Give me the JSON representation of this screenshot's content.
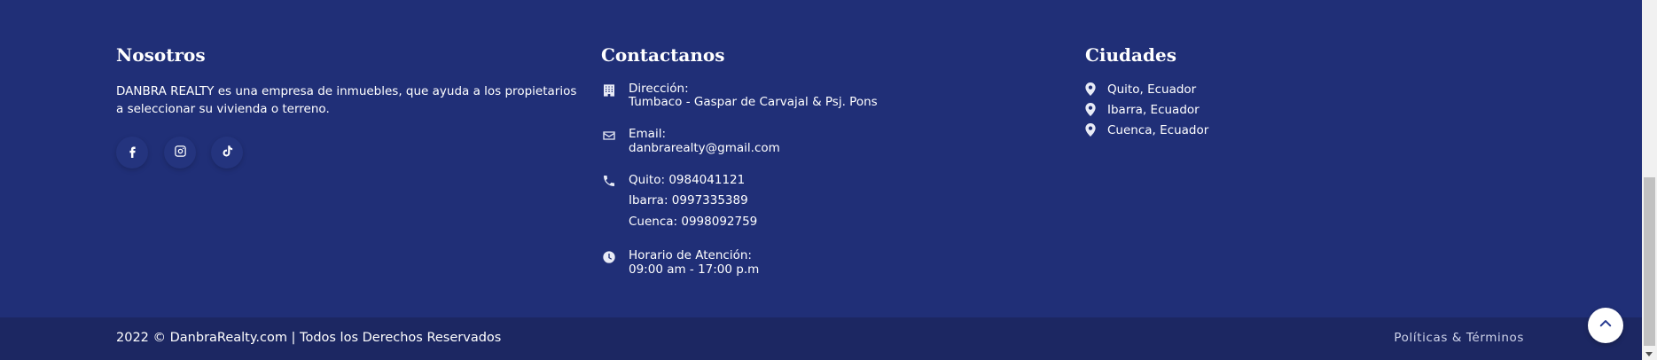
{
  "about": {
    "title": "Nosotros",
    "text": "DANBRA REALTY es una empresa de inmuebles, que ayuda a los propietarios a seleccionar su vivienda o terreno.",
    "social": [
      {
        "icon": "facebook-icon"
      },
      {
        "icon": "instagram-icon"
      },
      {
        "icon": "tiktok-icon"
      }
    ]
  },
  "contact": {
    "title": "Contactanos",
    "address_label": "Dirección:",
    "address_value": "Tumbaco - Gaspar de Carvajal & Psj. Pons",
    "email_label": "Email:",
    "email_value": "danbrarealty@gmail.com",
    "phones": [
      "Quito: 0984041121",
      "Ibarra: 0997335389",
      "Cuenca: 0998092759"
    ],
    "hours_label": "Horario de Atención:",
    "hours_value": "09:00 am - 17:00 p.m"
  },
  "cities": {
    "title": "Ciudades",
    "items": [
      "Quito, Ecuador",
      "Ibarra, Ecuador",
      "Cuenca, Ecuador"
    ]
  },
  "bottom": {
    "copyright": "2022 © DanbraRealty.com | Todos los Derechos Reservados",
    "policies": "Políticas & Términos"
  },
  "colors": {
    "footer_bg": "#202f77",
    "bottom_bar_bg": "#1c2762",
    "accent": "#2a3d91"
  }
}
